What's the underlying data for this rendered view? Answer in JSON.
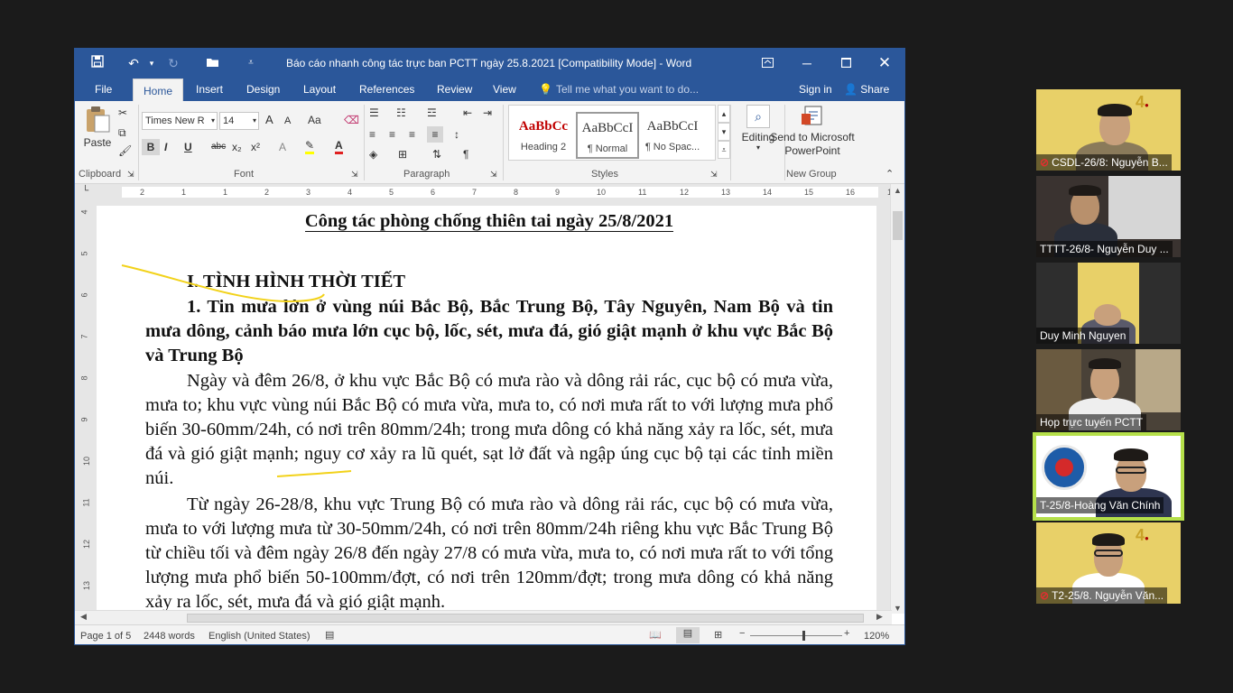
{
  "word": {
    "title": "Báo cáo nhanh công tác trực ban PCTT ngày 25.8.2021 [Compatibility Mode] - Word",
    "tabs": [
      {
        "label": "File"
      },
      {
        "label": "Home"
      },
      {
        "label": "Insert"
      },
      {
        "label": "Design"
      },
      {
        "label": "Layout"
      },
      {
        "label": "References"
      },
      {
        "label": "Review"
      },
      {
        "label": "View"
      }
    ],
    "tell_me": "Tell me what you want to do...",
    "sign_in": "Sign in",
    "share": "Share",
    "ribbon": {
      "paste": "Paste",
      "font_name": "Times New R",
      "font_size": "14",
      "grow_font": "A",
      "shrink_font": "A",
      "change_case": "Aa",
      "bold": "B",
      "italic": "I",
      "underline": "U",
      "strikethrough": "abc",
      "subscript": "x₂",
      "superscript": "x²",
      "text_effects": "A",
      "font_color": "A",
      "editing": "Editing",
      "send_line1": "Send to Microsoft",
      "send_line2": "PowerPoint",
      "groups": {
        "clipboard": "Clipboard",
        "font": "Font",
        "paragraph": "Paragraph",
        "styles": "Styles",
        "new_group": "New Group"
      },
      "styles": [
        {
          "sample": "AaBbCc",
          "name": "Heading 2",
          "color": "#c00000"
        },
        {
          "sample": "AaBbCcI",
          "name": "¶ Normal",
          "color": "#111111"
        },
        {
          "sample": "AaBbCcI",
          "name": "¶ No Spac...",
          "color": "#111111"
        }
      ]
    },
    "ruler_numbers": [
      "2",
      "1",
      "1",
      "2",
      "3",
      "4",
      "5",
      "6",
      "7",
      "8",
      "9",
      "10",
      "11",
      "12",
      "13",
      "14",
      "15",
      "16",
      "17",
      "18"
    ],
    "vruler_numbers": [
      "4",
      "5",
      "6",
      "7",
      "8",
      "9",
      "10",
      "11",
      "12",
      "13"
    ],
    "document": {
      "title": "Công tác phòng chống thiên tai ngày 25/8/2021",
      "heading": "I. TÌNH HÌNH THỜI TIẾT",
      "subheading": "1. Tin mưa lớn ở vùng núi Bắc Bộ, Bắc Trung Bộ, Tây Nguyên, Nam Bộ và tin mưa dông, cảnh báo mưa lớn cục bộ, lốc, sét, mưa đá, gió giật mạnh ở khu vực Bắc Bộ và Trung Bộ",
      "paragraph1": "Ngày và đêm 26/8, ở khu vực Bắc Bộ có mưa rào và dông rải rác, cục bộ có mưa vừa, mưa to; khu vực vùng núi Bắc Bộ có mưa vừa, mưa to, có nơi mưa rất to với lượng mưa phổ biến 30-60mm/24h, có nơi trên 80mm/24h; trong mưa dông có khả năng xảy ra lốc, sét, mưa đá và gió giật mạnh; nguy cơ xảy ra lũ quét, sạt lở đất và ngập úng cục bộ tại các tỉnh miền núi.",
      "paragraph2": "Từ ngày 26-28/8, khu vực Trung Bộ có mưa rào và dông rải rác, cục bộ có mưa vừa, mưa to với lượng mưa từ 30-50mm/24h, có nơi trên 80mm/24h riêng khu vực Bắc Trung Bộ từ chiều tối và đêm ngày 26/8 đến ngày 27/8 có mưa vừa, mưa to, có nơi mưa rất to với tổng lượng mưa phổ biến 50-100mm/đợt, có nơi trên 120mm/đợt; trong mưa dông có khả năng xảy ra lốc, sét, mưa đá và gió giật mạnh."
    },
    "status": {
      "page": "Page 1 of 5",
      "words": "2448 words",
      "language": "English (United States)",
      "zoom": "120%",
      "zoom_fraction": 0.58
    }
  },
  "participants": [
    {
      "name": "CSDL-26/8: Nguyễn B...",
      "muted": true
    },
    {
      "name": "TTTT-26/8- Nguyễn Duy ...",
      "muted": false
    },
    {
      "name": "Duy Minh Nguyen",
      "muted": false
    },
    {
      "name": "Họp trực tuyến PCTT",
      "muted": false
    },
    {
      "name": "T-25/8-Hoàng Văn Chính",
      "muted": false,
      "active_speaker": true
    },
    {
      "name": "T2-25/8. Nguyễn Văn...",
      "muted": true
    }
  ],
  "colors": {
    "word_blue": "#2b579a",
    "active_speaker_border": "#b5e04a",
    "muted_icon": "#e03030"
  }
}
